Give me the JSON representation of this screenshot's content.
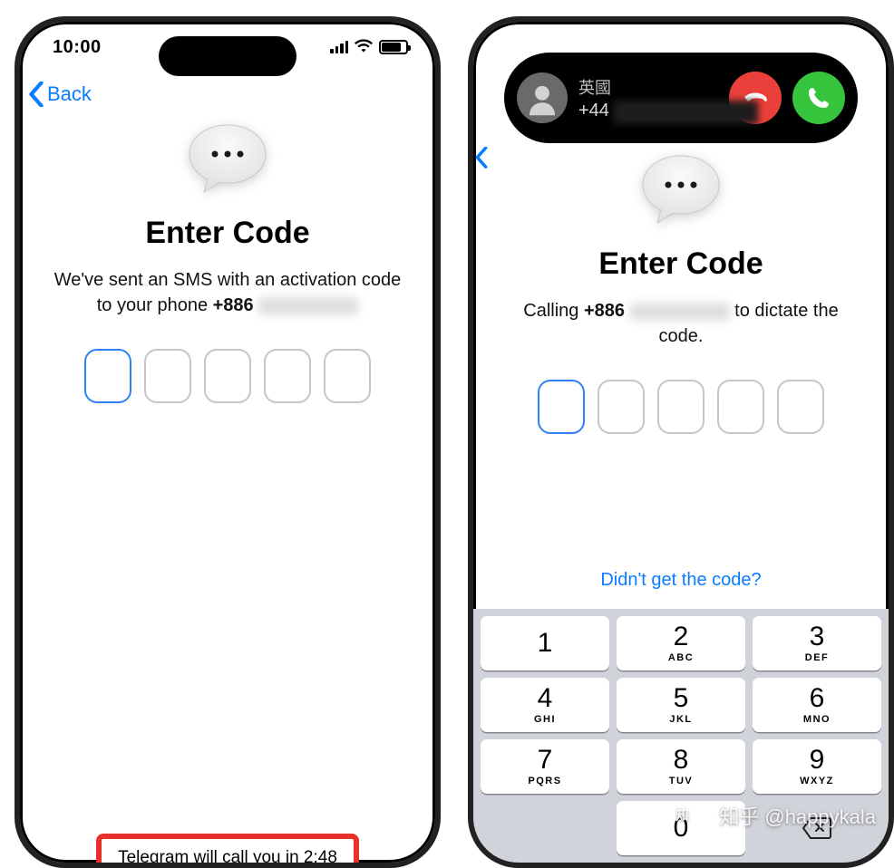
{
  "left": {
    "status": {
      "time": "10:00"
    },
    "back_label": "Back",
    "title": "Enter Code",
    "subtitle_prefix": "We've sent an SMS with an activation code to your phone ",
    "phone_prefix": "+886",
    "code_count": 5,
    "timer_text": "Telegram will call you in 2:48"
  },
  "right": {
    "title": "Enter Code",
    "subtitle_prefix": "Calling ",
    "phone_prefix": "+886",
    "subtitle_suffix": " to dictate the code.",
    "code_count": 5,
    "link_text": "Didn't get the code?",
    "call": {
      "name": "英國",
      "number_prefix": "+44"
    },
    "keypad": [
      [
        {
          "n": "1",
          "l": ""
        },
        {
          "n": "2",
          "l": "ABC"
        },
        {
          "n": "3",
          "l": "DEF"
        }
      ],
      [
        {
          "n": "4",
          "l": "GHI"
        },
        {
          "n": "5",
          "l": "JKL"
        },
        {
          "n": "6",
          "l": "MNO"
        }
      ],
      [
        {
          "n": "7",
          "l": "PQRS"
        },
        {
          "n": "8",
          "l": "TUV"
        },
        {
          "n": "9",
          "l": "WXYZ"
        }
      ],
      [
        {
          "empty": true
        },
        {
          "n": "0",
          "l": ""
        },
        {
          "del": true
        }
      ]
    ]
  },
  "watermark": "知乎 @happykala"
}
